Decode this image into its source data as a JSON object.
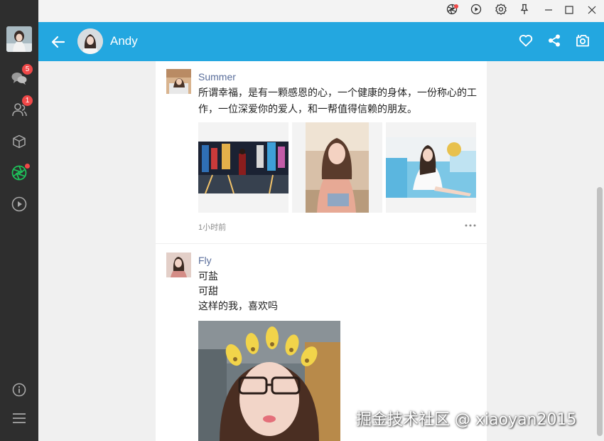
{
  "app": {
    "accent_color": "#23a7e0",
    "sidebar_color": "#2e2e2e",
    "badge_color": "#f04848"
  },
  "sidebar": {
    "items": [
      {
        "icon": "chat-icon",
        "badge": "5"
      },
      {
        "icon": "contacts-icon",
        "badge": "1"
      },
      {
        "icon": "cube-icon",
        "badge": ""
      },
      {
        "icon": "aperture-icon",
        "badge": ""
      },
      {
        "icon": "play-icon",
        "badge": ""
      }
    ],
    "bottom": [
      {
        "icon": "info-icon"
      },
      {
        "icon": "menu-icon"
      }
    ]
  },
  "titlebar": {
    "buttons": [
      "aperture-icon",
      "play-icon",
      "settings-icon",
      "pin-icon",
      "minimize-icon",
      "maximize-icon",
      "close-icon"
    ]
  },
  "header": {
    "name": "Andy",
    "actions": [
      "heart-icon",
      "share-icon",
      "camera-icon"
    ]
  },
  "posts": [
    {
      "name": "Summer",
      "text": "所谓幸福，是有一颗感恩的心，一个健康的身体，一份称心的工作，一位深爱你的爱人，和一帮值得信赖的朋友。",
      "images": [
        "city-night-street-photo",
        "girl-portrait-photo",
        "girl-on-sofa-photo"
      ],
      "time": "1小时前"
    },
    {
      "name": "Fly",
      "lines": [
        "可盐",
        "可甜",
        "这样的我，喜欢吗"
      ],
      "images": [
        "girl-flower-crown-photo"
      ]
    }
  ],
  "watermark": "掘金技术社区 @ xiaoyan2015"
}
